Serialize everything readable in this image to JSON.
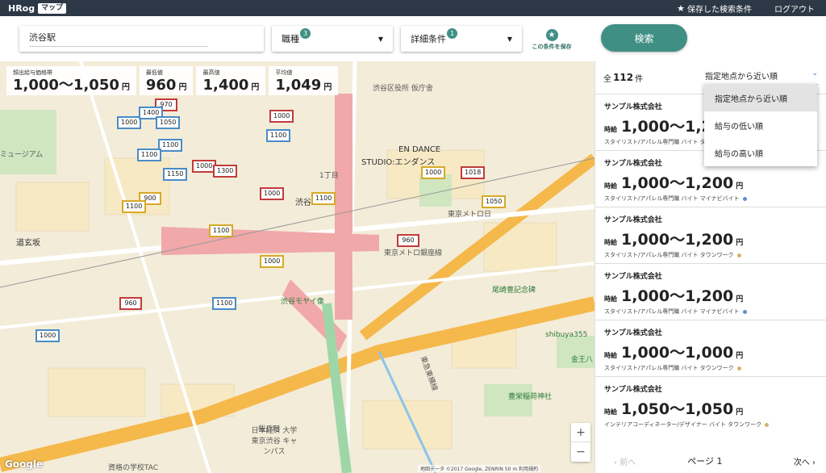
{
  "header": {
    "logo": "HRog",
    "logo_badge": "マップ",
    "saved_searches": "保存した検索条件",
    "logout": "ログアウト"
  },
  "search": {
    "location": "渋谷駅",
    "job_type_label": "職種",
    "job_type_count": "3",
    "detail_label": "詳細条件",
    "detail_count": "1",
    "save_condition": "この条件を保存",
    "search_button": "検索"
  },
  "stats": [
    {
      "label": "頻出給与価格帯",
      "value": "1,000〜1,050",
      "unit": "円"
    },
    {
      "label": "最低値",
      "value": "960",
      "unit": "円"
    },
    {
      "label": "最高値",
      "value": "1,400",
      "unit": "円"
    },
    {
      "label": "平均値",
      "value": "1,049",
      "unit": "円"
    }
  ],
  "map": {
    "pins": [
      "1000",
      "970",
      "1400",
      "1050",
      "1000",
      "1100",
      "1100",
      "1150",
      "1000",
      "1100",
      "1300",
      "900",
      "1100",
      "1000",
      "1100",
      "1000",
      "1100",
      "1000",
      "960",
      "1018",
      "1050",
      "960",
      "1000",
      "1100"
    ],
    "labels": {
      "station_area": "渋谷区役所 仮庁舎",
      "en_dance": "EN DANCE",
      "studio": "STUDIO:エンダンス",
      "museum": "ミュージアム",
      "tokyo_metro": "東京メトロ日",
      "metro_ginza": "東京メトロ銀座線",
      "moyai": "渋谷モヤイ像",
      "ozaki": "尾崎豊記念碑",
      "sakuragaoka": "桜丘町",
      "shibuya355": "shibuya355",
      "toyokawa": "豊栄稲荷神社",
      "univ": "日本経済 大学 東京渋谷 キャンパス",
      "tac": "資格の学校TAC",
      "dogenzaka": "道玄坂",
      "shibuya": "渋谷",
      "konno": "金王八",
      "tokyu": "東急東横線",
      "chome": "1丁目"
    },
    "google": "Google",
    "attribution": "地図データ ©2017 Google, ZENRIN   50 m   利用規約",
    "zoom_in": "+",
    "zoom_out": "−"
  },
  "results": {
    "prefix": "全",
    "count": "112",
    "suffix": "件",
    "sort_selected": "指定地点から近い順",
    "sort_options": [
      "指定地点から近い順",
      "給与の低い順",
      "給与の高い順"
    ],
    "wage_unit": "時給",
    "yen": "円",
    "cards": [
      {
        "company": "サンプル株式会社",
        "amount": "1,000〜1,200",
        "meta": "スタイリスト/アパレル専門職 バイト タウンワーク",
        "dot": "#d6b36a"
      },
      {
        "company": "サンプル株式会社",
        "amount": "1,000〜1,200",
        "meta": "スタイリスト/アパレル専門職 バイト マイナビバイト",
        "dot": "#5b8fd6"
      },
      {
        "company": "サンプル株式会社",
        "amount": "1,000〜1,200",
        "meta": "スタイリスト/アパレル専門職 バイト タウンワーク",
        "dot": "#d6b36a"
      },
      {
        "company": "サンプル株式会社",
        "amount": "1,000〜1,200",
        "meta": "スタイリスト/アパレル専門職 バイト マイナビバイト",
        "dot": "#5b8fd6"
      },
      {
        "company": "サンプル株式会社",
        "amount": "1,000〜1,000",
        "meta": "スタイリスト/アパレル専門職 バイト タウンワーク",
        "dot": "#d6b36a"
      },
      {
        "company": "サンプル株式会社",
        "amount": "1,050〜1,050",
        "meta": "インテリアコーディネーター/デザイナー バイト タウンワーク",
        "dot": "#d6b36a"
      }
    ],
    "pager": {
      "prev": "前へ",
      "page": "ページ 1",
      "next": "次へ"
    }
  },
  "colors": {
    "accent": "#3f8f84",
    "topbar": "#2c3845"
  }
}
